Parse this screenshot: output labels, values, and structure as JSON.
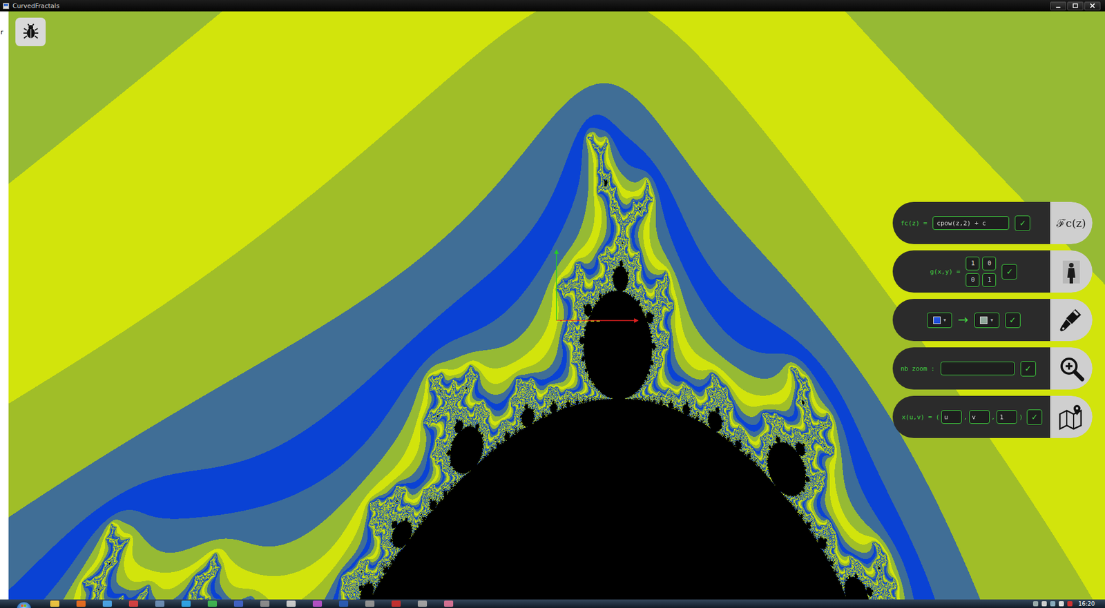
{
  "window": {
    "title": "CurvedFractals"
  },
  "background_window": {
    "text": "r"
  },
  "panel": {
    "rows": [
      {
        "kind": "formula",
        "label": "fc(z) =",
        "value": "cpow(z,2) + c",
        "confirm": "✓",
        "icon_text": "ℱc(z)"
      },
      {
        "kind": "matrix",
        "label": "g(x,y) =",
        "cells": [
          "1",
          "0",
          "0",
          "1"
        ],
        "confirm": "✓"
      },
      {
        "kind": "colors",
        "from": {
          "color": "#1f50dc",
          "caret": "▾"
        },
        "arrow": "→",
        "to": {
          "color": "#8fa89a",
          "caret": "▾"
        },
        "confirm": "✓"
      },
      {
        "kind": "zoom",
        "label": "nb zoom :",
        "value": "",
        "confirm": "✓"
      },
      {
        "kind": "param",
        "label": "x(u,v) = (",
        "fields": [
          "u",
          "v",
          "1"
        ],
        "separator": ",",
        "close": ")",
        "confirm": "✓"
      }
    ]
  },
  "taskbar": {
    "clock": "16:20"
  }
}
